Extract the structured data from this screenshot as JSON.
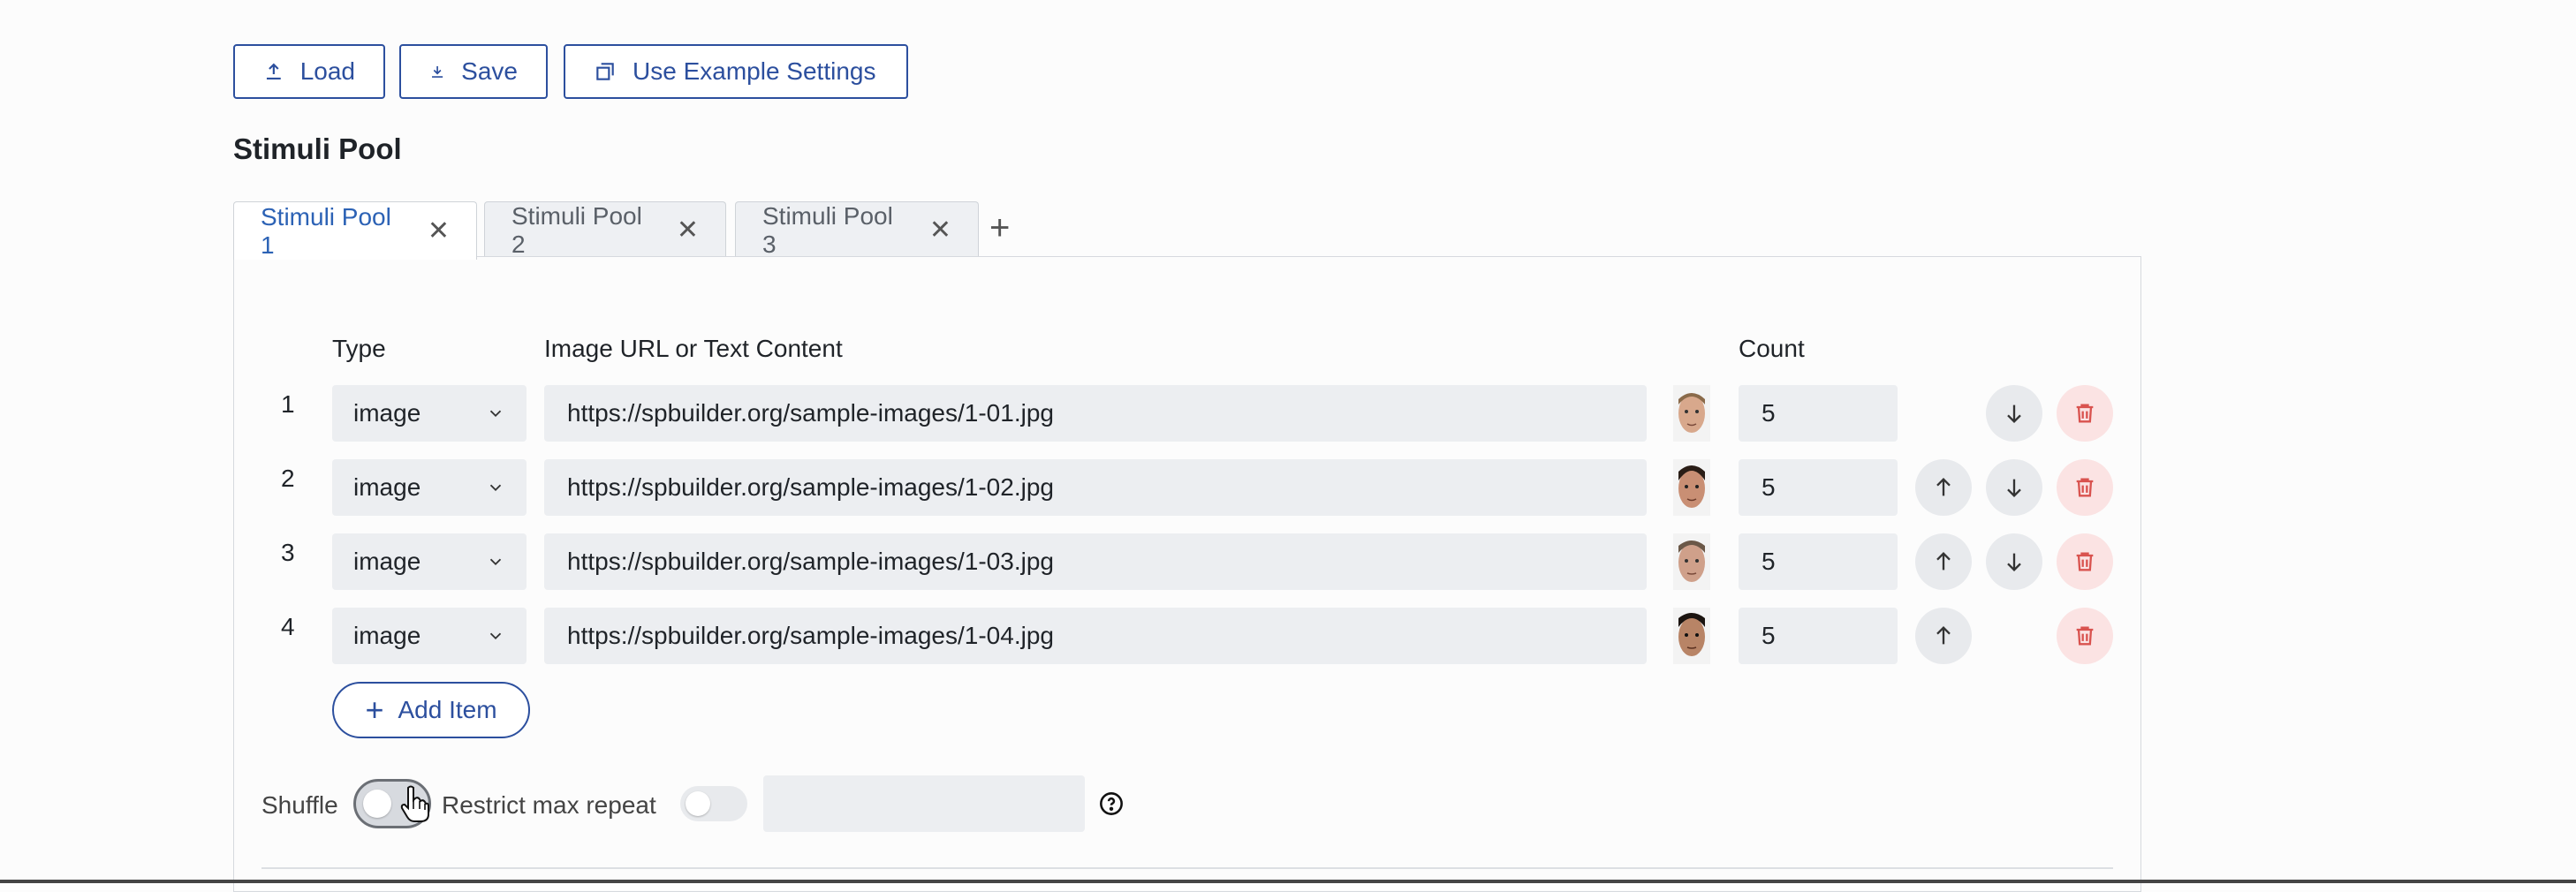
{
  "toolbar": {
    "load_label": "Load",
    "save_label": "Save",
    "example_label": "Use Example Settings"
  },
  "section_title": "Stimuli Pool",
  "tabs": [
    {
      "label": "Stimuli Pool 1",
      "active": true
    },
    {
      "label": "Stimuli Pool 2",
      "active": false
    },
    {
      "label": "Stimuli Pool 3",
      "active": false
    }
  ],
  "table": {
    "headers": {
      "type": "Type",
      "content": "Image URL or Text Content",
      "count": "Count"
    },
    "rows": [
      {
        "num": "1",
        "type": "image",
        "url": "https://spbuilder.org/sample-images/1-01.jpg",
        "count": "5"
      },
      {
        "num": "2",
        "type": "image",
        "url": "https://spbuilder.org/sample-images/1-02.jpg",
        "count": "5"
      },
      {
        "num": "3",
        "type": "image",
        "url": "https://spbuilder.org/sample-images/1-03.jpg",
        "count": "5"
      },
      {
        "num": "4",
        "type": "image",
        "url": "https://spbuilder.org/sample-images/1-04.jpg",
        "count": "5"
      }
    ]
  },
  "add_item_label": "Add Item",
  "options": {
    "shuffle_label": "Shuffle",
    "restrict_label": "Restrict max repeat",
    "max_repeat_value": ""
  },
  "colors": {
    "accent": "#2c4f9e",
    "danger": "#d9534f"
  }
}
